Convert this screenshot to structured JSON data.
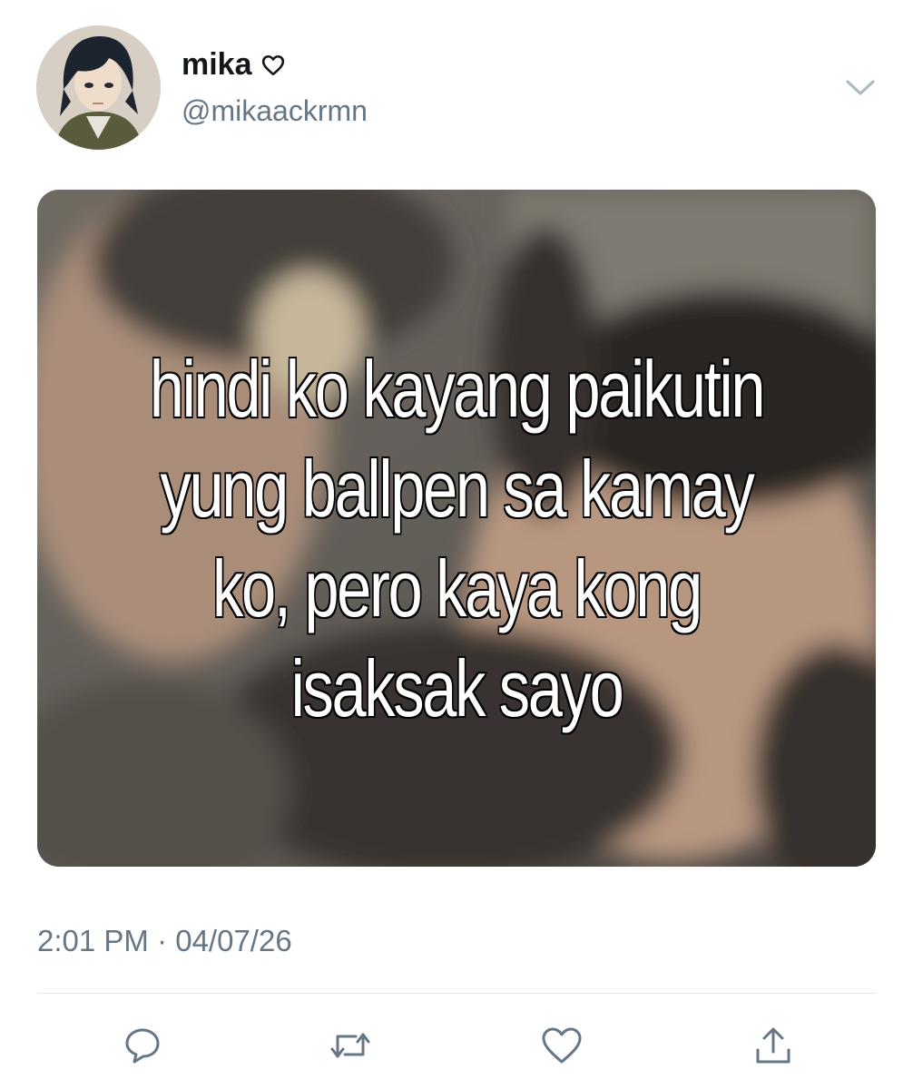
{
  "tweet": {
    "author": {
      "display_name": "mika",
      "name_icon": "heart-outline-icon",
      "handle": "@mikaackrmn",
      "avatar": "anime-character-avatar"
    },
    "menu_icon": "chevron-down-icon",
    "media": {
      "caption_lines": [
        "hindi ko kayang paikutin",
        "yung ballpen sa kamay",
        "ko, pero kaya kong",
        "isaksak sayo"
      ]
    },
    "timestamp": "2:01 PM · 04/07/26",
    "actions": [
      {
        "name": "reply",
        "icon": "speech-bubble-icon"
      },
      {
        "name": "retweet",
        "icon": "retweet-icon"
      },
      {
        "name": "like",
        "icon": "heart-outline-icon"
      },
      {
        "name": "share",
        "icon": "share-icon"
      }
    ]
  },
  "colors": {
    "primary_text": "#14171a",
    "secondary_text": "#657786",
    "divider": "#e1e8ed",
    "icon": "#657786"
  }
}
